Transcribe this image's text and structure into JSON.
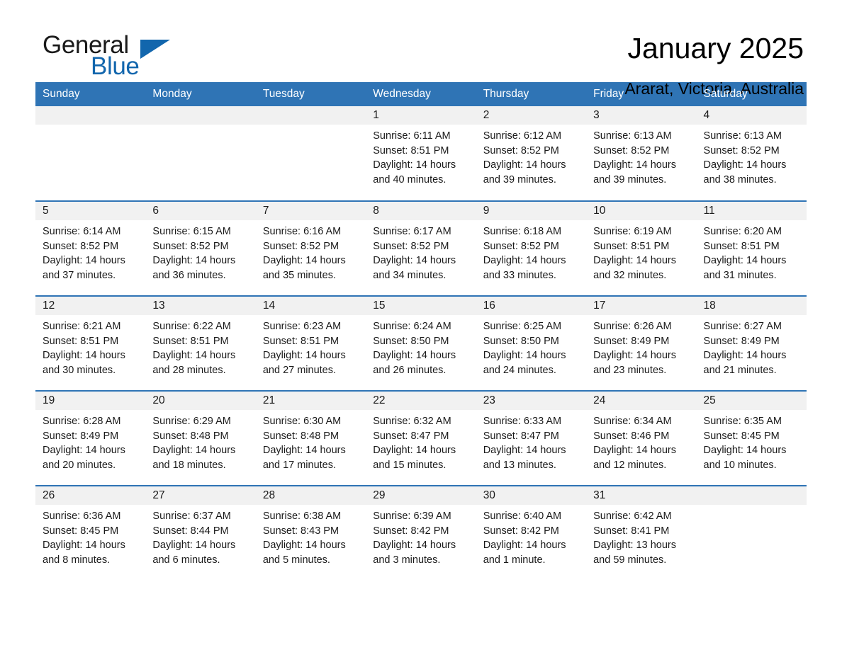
{
  "brand": {
    "word1": "General",
    "word2": "Blue",
    "triangle_color": "#1266ad",
    "word2_color": "#1266ad"
  },
  "header": {
    "month_title": "January 2025",
    "location": "Ararat, Victoria, Australia"
  },
  "theme": {
    "header_blue": "#2f74b5",
    "row_divider_blue": "#2f74b5",
    "daynum_band_gray": "#f1f1f1",
    "text_color": "#1a1a1a",
    "page_background": "#ffffff"
  },
  "weekdays": [
    "Sunday",
    "Monday",
    "Tuesday",
    "Wednesday",
    "Thursday",
    "Friday",
    "Saturday"
  ],
  "labels": {
    "sunrise_prefix": "Sunrise:",
    "sunset_prefix": "Sunset:",
    "daylight_prefix": "Daylight:"
  },
  "weeks": [
    [
      {
        "day": "",
        "line1": "",
        "line2": "",
        "line3": "",
        "line4": ""
      },
      {
        "day": "",
        "line1": "",
        "line2": "",
        "line3": "",
        "line4": ""
      },
      {
        "day": "",
        "line1": "",
        "line2": "",
        "line3": "",
        "line4": ""
      },
      {
        "day": "1",
        "line1": "Sunrise: 6:11 AM",
        "line2": "Sunset: 8:51 PM",
        "line3": "Daylight: 14 hours",
        "line4": "and 40 minutes."
      },
      {
        "day": "2",
        "line1": "Sunrise: 6:12 AM",
        "line2": "Sunset: 8:52 PM",
        "line3": "Daylight: 14 hours",
        "line4": "and 39 minutes."
      },
      {
        "day": "3",
        "line1": "Sunrise: 6:13 AM",
        "line2": "Sunset: 8:52 PM",
        "line3": "Daylight: 14 hours",
        "line4": "and 39 minutes."
      },
      {
        "day": "4",
        "line1": "Sunrise: 6:13 AM",
        "line2": "Sunset: 8:52 PM",
        "line3": "Daylight: 14 hours",
        "line4": "and 38 minutes."
      }
    ],
    [
      {
        "day": "5",
        "line1": "Sunrise: 6:14 AM",
        "line2": "Sunset: 8:52 PM",
        "line3": "Daylight: 14 hours",
        "line4": "and 37 minutes."
      },
      {
        "day": "6",
        "line1": "Sunrise: 6:15 AM",
        "line2": "Sunset: 8:52 PM",
        "line3": "Daylight: 14 hours",
        "line4": "and 36 minutes."
      },
      {
        "day": "7",
        "line1": "Sunrise: 6:16 AM",
        "line2": "Sunset: 8:52 PM",
        "line3": "Daylight: 14 hours",
        "line4": "and 35 minutes."
      },
      {
        "day": "8",
        "line1": "Sunrise: 6:17 AM",
        "line2": "Sunset: 8:52 PM",
        "line3": "Daylight: 14 hours",
        "line4": "and 34 minutes."
      },
      {
        "day": "9",
        "line1": "Sunrise: 6:18 AM",
        "line2": "Sunset: 8:52 PM",
        "line3": "Daylight: 14 hours",
        "line4": "and 33 minutes."
      },
      {
        "day": "10",
        "line1": "Sunrise: 6:19 AM",
        "line2": "Sunset: 8:51 PM",
        "line3": "Daylight: 14 hours",
        "line4": "and 32 minutes."
      },
      {
        "day": "11",
        "line1": "Sunrise: 6:20 AM",
        "line2": "Sunset: 8:51 PM",
        "line3": "Daylight: 14 hours",
        "line4": "and 31 minutes."
      }
    ],
    [
      {
        "day": "12",
        "line1": "Sunrise: 6:21 AM",
        "line2": "Sunset: 8:51 PM",
        "line3": "Daylight: 14 hours",
        "line4": "and 30 minutes."
      },
      {
        "day": "13",
        "line1": "Sunrise: 6:22 AM",
        "line2": "Sunset: 8:51 PM",
        "line3": "Daylight: 14 hours",
        "line4": "and 28 minutes."
      },
      {
        "day": "14",
        "line1": "Sunrise: 6:23 AM",
        "line2": "Sunset: 8:51 PM",
        "line3": "Daylight: 14 hours",
        "line4": "and 27 minutes."
      },
      {
        "day": "15",
        "line1": "Sunrise: 6:24 AM",
        "line2": "Sunset: 8:50 PM",
        "line3": "Daylight: 14 hours",
        "line4": "and 26 minutes."
      },
      {
        "day": "16",
        "line1": "Sunrise: 6:25 AM",
        "line2": "Sunset: 8:50 PM",
        "line3": "Daylight: 14 hours",
        "line4": "and 24 minutes."
      },
      {
        "day": "17",
        "line1": "Sunrise: 6:26 AM",
        "line2": "Sunset: 8:49 PM",
        "line3": "Daylight: 14 hours",
        "line4": "and 23 minutes."
      },
      {
        "day": "18",
        "line1": "Sunrise: 6:27 AM",
        "line2": "Sunset: 8:49 PM",
        "line3": "Daylight: 14 hours",
        "line4": "and 21 minutes."
      }
    ],
    [
      {
        "day": "19",
        "line1": "Sunrise: 6:28 AM",
        "line2": "Sunset: 8:49 PM",
        "line3": "Daylight: 14 hours",
        "line4": "and 20 minutes."
      },
      {
        "day": "20",
        "line1": "Sunrise: 6:29 AM",
        "line2": "Sunset: 8:48 PM",
        "line3": "Daylight: 14 hours",
        "line4": "and 18 minutes."
      },
      {
        "day": "21",
        "line1": "Sunrise: 6:30 AM",
        "line2": "Sunset: 8:48 PM",
        "line3": "Daylight: 14 hours",
        "line4": "and 17 minutes."
      },
      {
        "day": "22",
        "line1": "Sunrise: 6:32 AM",
        "line2": "Sunset: 8:47 PM",
        "line3": "Daylight: 14 hours",
        "line4": "and 15 minutes."
      },
      {
        "day": "23",
        "line1": "Sunrise: 6:33 AM",
        "line2": "Sunset: 8:47 PM",
        "line3": "Daylight: 14 hours",
        "line4": "and 13 minutes."
      },
      {
        "day": "24",
        "line1": "Sunrise: 6:34 AM",
        "line2": "Sunset: 8:46 PM",
        "line3": "Daylight: 14 hours",
        "line4": "and 12 minutes."
      },
      {
        "day": "25",
        "line1": "Sunrise: 6:35 AM",
        "line2": "Sunset: 8:45 PM",
        "line3": "Daylight: 14 hours",
        "line4": "and 10 minutes."
      }
    ],
    [
      {
        "day": "26",
        "line1": "Sunrise: 6:36 AM",
        "line2": "Sunset: 8:45 PM",
        "line3": "Daylight: 14 hours",
        "line4": "and 8 minutes."
      },
      {
        "day": "27",
        "line1": "Sunrise: 6:37 AM",
        "line2": "Sunset: 8:44 PM",
        "line3": "Daylight: 14 hours",
        "line4": "and 6 minutes."
      },
      {
        "day": "28",
        "line1": "Sunrise: 6:38 AM",
        "line2": "Sunset: 8:43 PM",
        "line3": "Daylight: 14 hours",
        "line4": "and 5 minutes."
      },
      {
        "day": "29",
        "line1": "Sunrise: 6:39 AM",
        "line2": "Sunset: 8:42 PM",
        "line3": "Daylight: 14 hours",
        "line4": "and 3 minutes."
      },
      {
        "day": "30",
        "line1": "Sunrise: 6:40 AM",
        "line2": "Sunset: 8:42 PM",
        "line3": "Daylight: 14 hours",
        "line4": "and 1 minute."
      },
      {
        "day": "31",
        "line1": "Sunrise: 6:42 AM",
        "line2": "Sunset: 8:41 PM",
        "line3": "Daylight: 13 hours",
        "line4": "and 59 minutes."
      },
      {
        "day": "",
        "line1": "",
        "line2": "",
        "line3": "",
        "line4": ""
      }
    ]
  ]
}
